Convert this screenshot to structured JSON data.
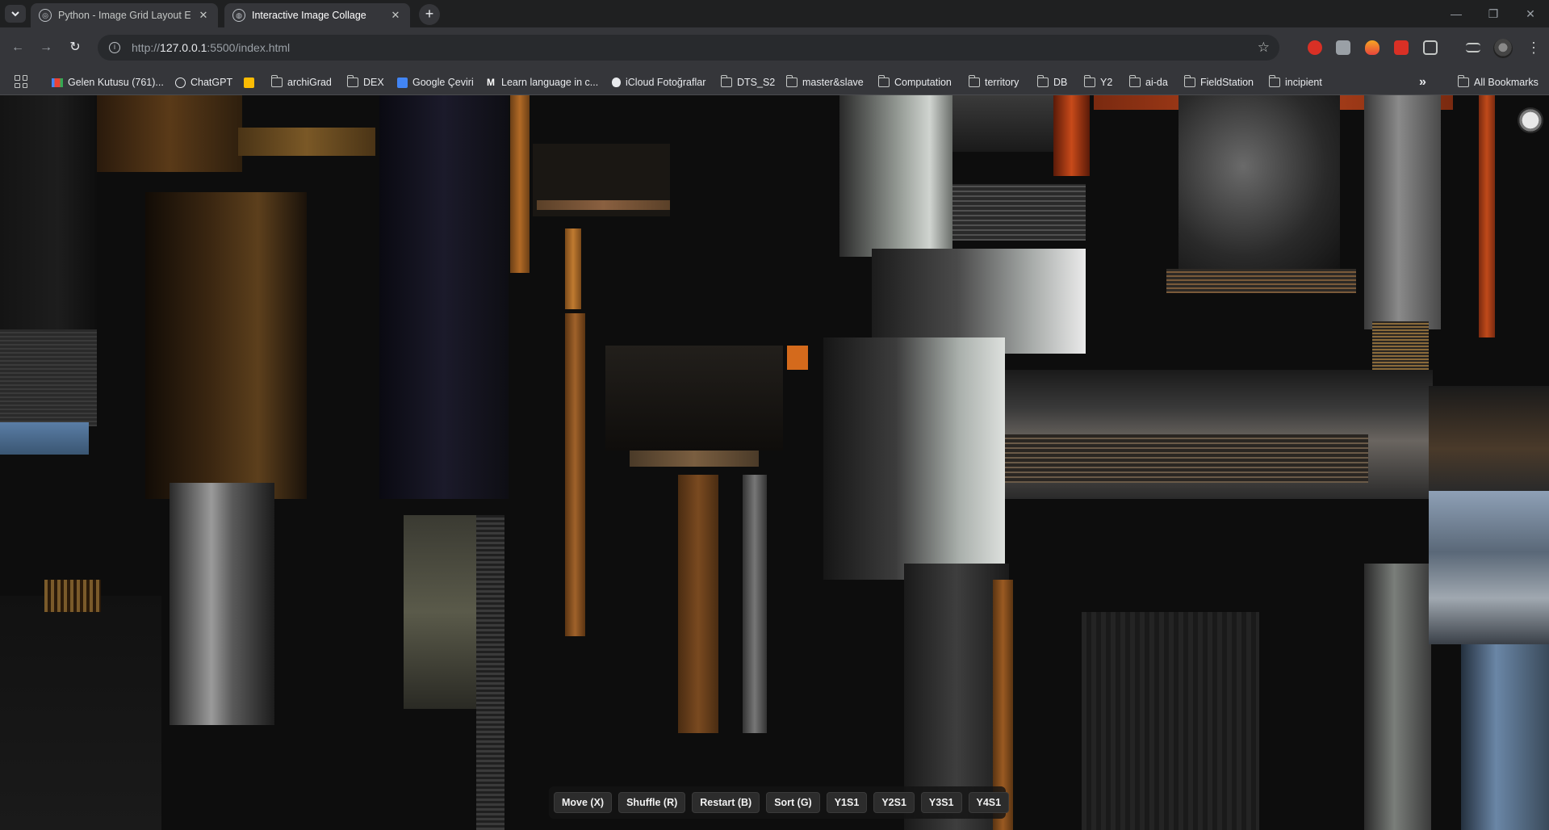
{
  "browser": {
    "tabs": [
      {
        "title": "Python - Image Grid Layout En",
        "active": false,
        "icon": "chatgpt-icon"
      },
      {
        "title": "Interactive Image Collage",
        "active": true,
        "icon": "globe-icon"
      }
    ],
    "address_bar": {
      "url_prefix": "http://",
      "url_host": "127.0.0.1",
      "url_rest": ":5500/index.html"
    },
    "bookmarks": [
      {
        "label": "Gelen Kutusu (761)...",
        "icon": "gmail-icon"
      },
      {
        "label": "ChatGPT",
        "icon": "chatgpt-icon"
      },
      {
        "label": "",
        "icon": "calendar-icon"
      },
      {
        "label": "archiGrad",
        "icon": "folder-icon"
      },
      {
        "label": "DEX",
        "icon": "folder-icon"
      },
      {
        "label": "Google Çeviri",
        "icon": "translate-icon"
      },
      {
        "label": "Learn language in c...",
        "icon": "m-icon"
      },
      {
        "label": "iCloud Fotoğraflar",
        "icon": "apple-icon"
      },
      {
        "label": "DTS_S2",
        "icon": "folder-icon"
      },
      {
        "label": "master&slave",
        "icon": "folder-icon"
      },
      {
        "label": "Computation",
        "icon": "folder-icon"
      },
      {
        "label": "territory",
        "icon": "folder-icon"
      },
      {
        "label": "DB",
        "icon": "folder-icon"
      },
      {
        "label": "Y2",
        "icon": "folder-icon"
      },
      {
        "label": "ai-da",
        "icon": "folder-icon"
      },
      {
        "label": "FieldStation",
        "icon": "folder-icon"
      },
      {
        "label": "incipient",
        "icon": "folder-icon"
      }
    ],
    "overflow_label": "»",
    "all_bookmarks_label": "All Bookmarks",
    "colors": {
      "frame": "#1f2021",
      "toolbar": "#35363a",
      "omnibox": "#282a2d"
    }
  },
  "collage": {
    "controls": [
      {
        "label": "Move (X)"
      },
      {
        "label": "Shuffle (R)"
      },
      {
        "label": "Restart (B)"
      },
      {
        "label": "Sort (G)"
      },
      {
        "label": "Y1S1"
      },
      {
        "label": "Y2S1"
      },
      {
        "label": "Y3S1"
      },
      {
        "label": "Y4S1"
      }
    ]
  }
}
